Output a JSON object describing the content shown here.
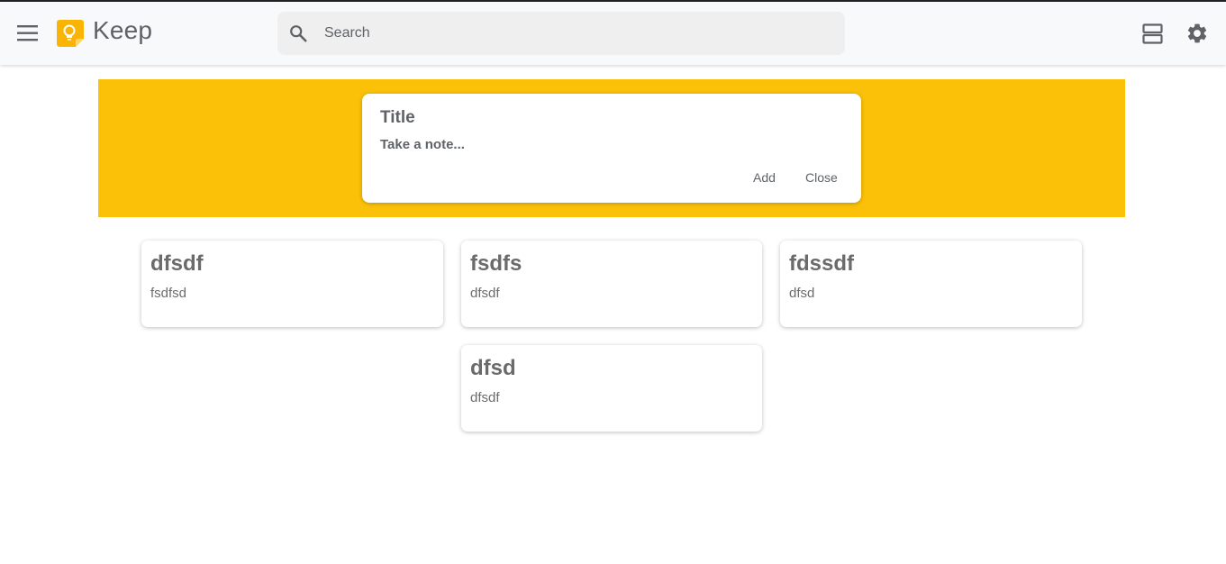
{
  "header": {
    "app_title": "Keep",
    "menu_icon": "hamburger-menu-icon",
    "logo_icon": "keep-lightbulb-logo",
    "search": {
      "placeholder": "Search",
      "value": "",
      "icon": "search-icon"
    },
    "view_toggle_icon": "list-view-icon",
    "settings_icon": "gear-icon"
  },
  "composer": {
    "title_placeholder": "Title",
    "body_placeholder": "Take a note...",
    "add_label": "Add",
    "close_label": "Close"
  },
  "notes": [
    {
      "title": "dfsdf",
      "content": "fsdfsd"
    },
    {
      "title": "fsdfs",
      "content": "dfsdf"
    },
    {
      "title": "fdssdf",
      "content": "dfsd"
    },
    {
      "title": "dfsd",
      "content": "dfsdf"
    }
  ],
  "colors": {
    "banner": "#fbc109",
    "logo": "#f9b406",
    "header_bg": "#f8f9fa",
    "text": "#5f6368"
  }
}
